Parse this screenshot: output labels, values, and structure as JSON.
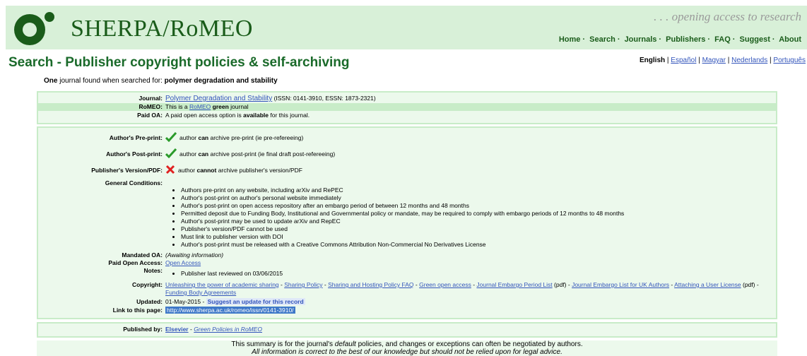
{
  "header": {
    "logo_text": "SHERPA/RoMEO",
    "tagline": ". . . opening access to research",
    "nav": [
      "Home",
      "Search",
      "Journals",
      "Publishers",
      "FAQ",
      "Suggest",
      "About"
    ]
  },
  "page_title": "Search - Publisher copyright policies & self-archiving",
  "languages": {
    "current": "English",
    "others": [
      "Español",
      "Magyar",
      "Nederlands",
      "Português"
    ]
  },
  "result_line": {
    "count": "One",
    "middle": " journal found when searched for: ",
    "query": "polymer degradation and stability"
  },
  "journal": {
    "journal_label": "Journal:",
    "journal_title": "Polymer Degradation and Stability",
    "issn": " (ISSN: 0141-3910, ESSN: 1873-2321)",
    "romeo_label": "RoMEO:",
    "romeo_prefix": "This is a ",
    "romeo_link": "RoMEO",
    "romeo_color": "green",
    "romeo_suffix": " journal",
    "paid_oa_label": "Paid OA:",
    "paid_oa_prefix": "A paid open access option is ",
    "paid_oa_bold": "available",
    "paid_oa_suffix": " for this journal."
  },
  "policy": {
    "preprint_label": "Author's Pre-print:",
    "preprint_pre": "author ",
    "preprint_bold": "can",
    "preprint_post": " archive pre-print (ie pre-refereeing)",
    "postprint_label": "Author's Post-print:",
    "postprint_pre": "author ",
    "postprint_bold": "can",
    "postprint_post": " archive post-print (ie final draft post-refereeing)",
    "pubver_label": "Publisher's Version/PDF:",
    "pubver_pre": "author ",
    "pubver_bold": "cannot",
    "pubver_post": " archive publisher's version/PDF",
    "general_label": "General Conditions:",
    "conditions": [
      "Authors pre-print on any website, including arXiv and RePEC",
      "Author's post-print on author's personal website immediately",
      "Author's post-print on open access repository after an embargo period of between 12 months and 48 months",
      "Permitted deposit due to Funding Body, Institutional and Governmental policy or mandate, may be required to comply with embargo periods of 12 months to 48 months",
      "Author's post-print may be used to update arXiv and RepEC",
      "Publisher's version/PDF cannot be used",
      "Must link to publisher version with DOI",
      "Author's post-print must be released with a Creative Commons Attribution Non-Commercial No Derivatives License"
    ],
    "mandated_label": "Mandated OA:",
    "mandated_value": "(Awaiting information)",
    "paid_access_label": "Paid Open Access:",
    "paid_access_link": "Open Access",
    "notes_label": "Notes:",
    "notes": [
      "Publisher last reviewed on 03/06/2015"
    ],
    "copyright_label": "Copyright:",
    "copyright_links": {
      "l1": "Unleashing the power of academic sharing",
      "l2": "Sharing Policy",
      "l3": "Sharing and Hosting Policy FAQ",
      "l4": "Green open access",
      "l5": "Journal Embargo Period List",
      "pdf": " (pdf) - ",
      "l6": "Journal Embargo List for UK Authors",
      "l7": "Attaching a User License",
      "pdf2": " (pdf) -",
      "l8": "Funding Body Agreements",
      "dash": " - "
    },
    "updated_label": "Updated:",
    "updated_value": "01-May-2015 - ",
    "suggest_link": "Suggest an update for this record",
    "link_label": "Link to this page:",
    "link_value": "http://www.sherpa.ac.uk/romeo/issn/0141-3910/"
  },
  "publisher": {
    "label": "Published by:",
    "name": "Elsevier",
    "sep": " - ",
    "green_link": "Green Policies in RoMEO"
  },
  "summary": {
    "line1_pre": "This summary is for the journal's ",
    "line1_em": "default",
    "line1_post": " policies, and changes or exceptions can often be negotiated by authors.",
    "line2": "All information is correct to the best of our knowledge but should not be relied upon for legal advice."
  },
  "colors": {
    "header_bg": "#d8f0d8",
    "brand_green": "#1a5c1a",
    "title_green": "#1a6a2a",
    "box_bg": "#ecf9ec",
    "box_border": "#c8ecc8",
    "link_blue": "#3355bb",
    "check_green": "#2a9a2a",
    "cross_red": "#e02020"
  }
}
